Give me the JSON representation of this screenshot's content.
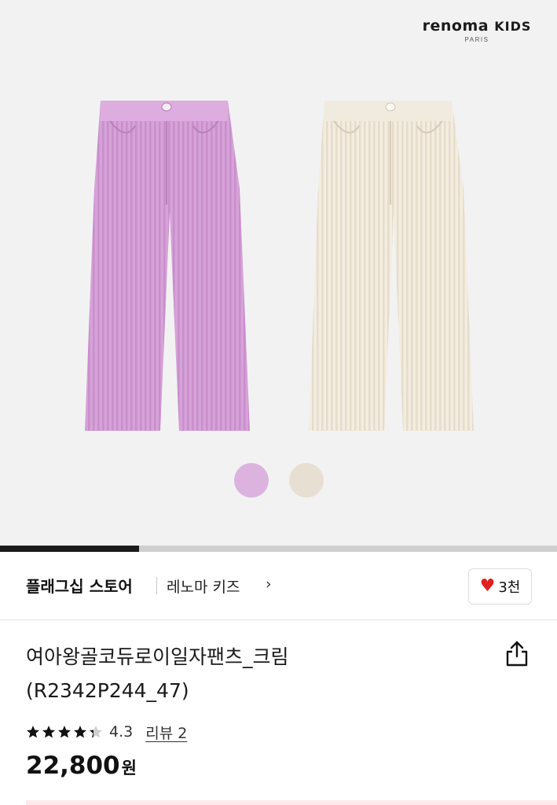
{
  "brand": {
    "name": "renoma",
    "kids": "KIDS",
    "sub": "PARIS"
  },
  "gallery": {
    "images": [
      {
        "color_name": "pink",
        "color": "#d8a8da"
      },
      {
        "color_name": "cream",
        "color": "#f3ede0"
      }
    ],
    "swatches": [
      {
        "color": "#dcb3df"
      },
      {
        "color": "#e8dfd3"
      }
    ],
    "progress_fraction": 0.25
  },
  "store": {
    "flagship_label": "플래그십 스토어",
    "name": "레노마 키즈",
    "chevron": "›",
    "like_icon": "heart-icon",
    "like_count": "3천"
  },
  "product": {
    "title_line1": "여아왕골코듀로이일자팬츠_크림",
    "title_line2": "(R2342P244_47)",
    "share_icon": "share-icon",
    "rating": "4.3",
    "rating_stars": 4.3,
    "review_label": "리뷰 2",
    "price": "22,800",
    "currency": "원"
  },
  "colors": {
    "like_heart": "#e02020",
    "text": "#111111",
    "hero_bg": "#f2f2f3"
  }
}
